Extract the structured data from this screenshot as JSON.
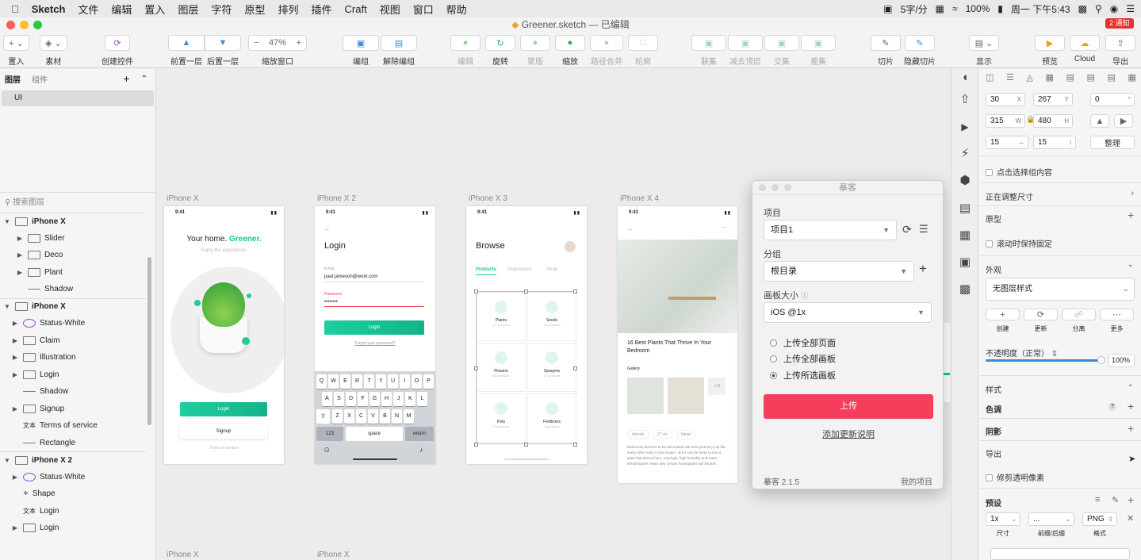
{
  "menubar": {
    "apple": "",
    "app": "Sketch",
    "items": [
      "文件",
      "编辑",
      "置入",
      "图层",
      "字符",
      "原型",
      "排列",
      "插件",
      "Craft",
      "视图",
      "窗口",
      "帮助"
    ],
    "status": {
      "rate": "5字/分",
      "battery": "100%",
      "datetime": "周一 下午5:43"
    }
  },
  "titlebar": {
    "title": "Greener.sketch — 已编辑",
    "notifications": "2 通知"
  },
  "toolbar": {
    "insert": "置入",
    "assets": "素材",
    "create_symbol": "创建控件",
    "forward": "前置一层",
    "backward": "后置一层",
    "zoom": "47%",
    "zoom_label": "缩放窗口",
    "group": "编组",
    "ungroup": "解除编组",
    "edit": "编辑",
    "rotate": "旋转",
    "mask": "蒙版",
    "scale": "缩放",
    "flatten": "路径合并",
    "outline": "轮廓",
    "union": "联集",
    "subtract": "减去顶层",
    "intersect": "交集",
    "difference": "差集",
    "slice": "切片",
    "hide_slice": "隐藏切片",
    "display": "显示",
    "preview": "预览",
    "cloud": "Cloud",
    "export": "导出"
  },
  "left_panel": {
    "tab_layers": "图层",
    "tab_components": "组件",
    "page": "UI",
    "search_placeholder": "搜索图层",
    "layers": [
      {
        "name": "iPhone X",
        "type": "artboard"
      },
      {
        "name": "Slider",
        "type": "folder"
      },
      {
        "name": "Deco",
        "type": "folder"
      },
      {
        "name": "Plant",
        "type": "folder"
      },
      {
        "name": "Shadow",
        "type": "line"
      },
      {
        "name": "iPhone X",
        "type": "artboard"
      },
      {
        "name": "Status-White",
        "type": "symbol"
      },
      {
        "name": "Claim",
        "type": "folder"
      },
      {
        "name": "Illustration",
        "type": "folder"
      },
      {
        "name": "Login",
        "type": "folder"
      },
      {
        "name": "Shadow",
        "type": "line"
      },
      {
        "name": "Signup",
        "type": "folder"
      },
      {
        "name": "Terms of service",
        "type": "text"
      },
      {
        "name": "Rectangle",
        "type": "line"
      },
      {
        "name": "iPhone X 2",
        "type": "artboard"
      },
      {
        "name": "Status-White",
        "type": "symbol"
      },
      {
        "name": "Shape",
        "type": "shape"
      },
      {
        "name": "Login",
        "type": "text"
      },
      {
        "name": "Login",
        "type": "folder"
      }
    ]
  },
  "canvas": {
    "artboards": [
      "iPhone X",
      "iPhone X 2",
      "iPhone X 3",
      "iPhone X 4"
    ],
    "bottom_labels": [
      "iPhone X",
      "iPhone X"
    ],
    "status_time": "9:41",
    "home": {
      "title": "Your home.",
      "brand": "Greener.",
      "subtitle": "Enjoy the experience.",
      "login": "Login",
      "signup": "Signup",
      "terms": "Terms of service"
    },
    "login": {
      "title": "Login",
      "email_label": "Email",
      "email": "paul.jameson@work.com",
      "password_label": "Password",
      "password": "••••••••",
      "button": "Login",
      "forgot": "Forgot your password?",
      "keys_row1": [
        "Q",
        "W",
        "E",
        "R",
        "T",
        "Y",
        "U",
        "I",
        "O",
        "P"
      ],
      "keys_row2": [
        "A",
        "S",
        "D",
        "F",
        "G",
        "H",
        "J",
        "K",
        "L"
      ],
      "keys_row3": [
        "Z",
        "X",
        "C",
        "V",
        "B",
        "N",
        "M"
      ],
      "key_123": "123",
      "key_space": "space",
      "key_return": "return"
    },
    "browse": {
      "title": "Browse",
      "tabs": [
        "Products",
        "Inspirations",
        "Shop"
      ],
      "cards": [
        {
          "name": "Plants",
          "sub": "147 products"
        },
        {
          "name": "Seeds",
          "sub": "16 products"
        },
        {
          "name": "Flowers",
          "sub": "68 products"
        },
        {
          "name": "Sprayers",
          "sub": "17 products"
        },
        {
          "name": "Pots",
          "sub": "47 products"
        },
        {
          "name": "Fertilizers",
          "sub": "9 products"
        }
      ]
    },
    "article": {
      "title": "16 Best Plants That Thrive In Your Bedroom",
      "gallery": "Gallery",
      "more": "+13",
      "tags": [
        "Interior",
        "27 m²",
        "Ideas"
      ],
      "body": "Bedrooms deserve to be decorated with lush greenery just like every other room in the house – but it can be tricky to find a plant that thrives here. Low light, high humidity and warm temperatures mean only certain houseplants will flourish."
    }
  },
  "dialog": {
    "title": "摹客",
    "project_label": "项目",
    "project": "项目1",
    "group_label": "分组",
    "group": "根目录",
    "size_label": "画板大小",
    "size": "iOS @1x",
    "options": [
      "上传全部页面",
      "上传全部画板",
      "上传所选画板"
    ],
    "selected_option": 2,
    "upload": "上传",
    "add_note": "添加更新说明",
    "version": "摹客 2.1.5",
    "my_projects": "我的项目"
  },
  "inspector": {
    "x": "30",
    "y": "267",
    "rotation": "0",
    "w": "315",
    "h": "480",
    "pad_x": "15",
    "pad_y": "15",
    "tidy": "整理",
    "click_select": "点击选择组内容",
    "resizing": "正在调整尺寸",
    "prototype": "原型",
    "fix_scroll": "滚动时保持固定",
    "appearance": "外观",
    "layer_style": "无图层样式",
    "create": "创建",
    "update": "更新",
    "detach": "分离",
    "more": "更多",
    "opacity_label": "不透明度（正常）",
    "opacity": "100%",
    "style": "样式",
    "tint": "色调",
    "shadow": "阴影",
    "export": "导出",
    "trim": "修剪透明像素",
    "presets": "预设",
    "scale": "1x",
    "suffix": "...",
    "format": "PNG",
    "col_size": "尺寸",
    "col_prefix": "前缀/后缀",
    "col_format": "格式"
  }
}
